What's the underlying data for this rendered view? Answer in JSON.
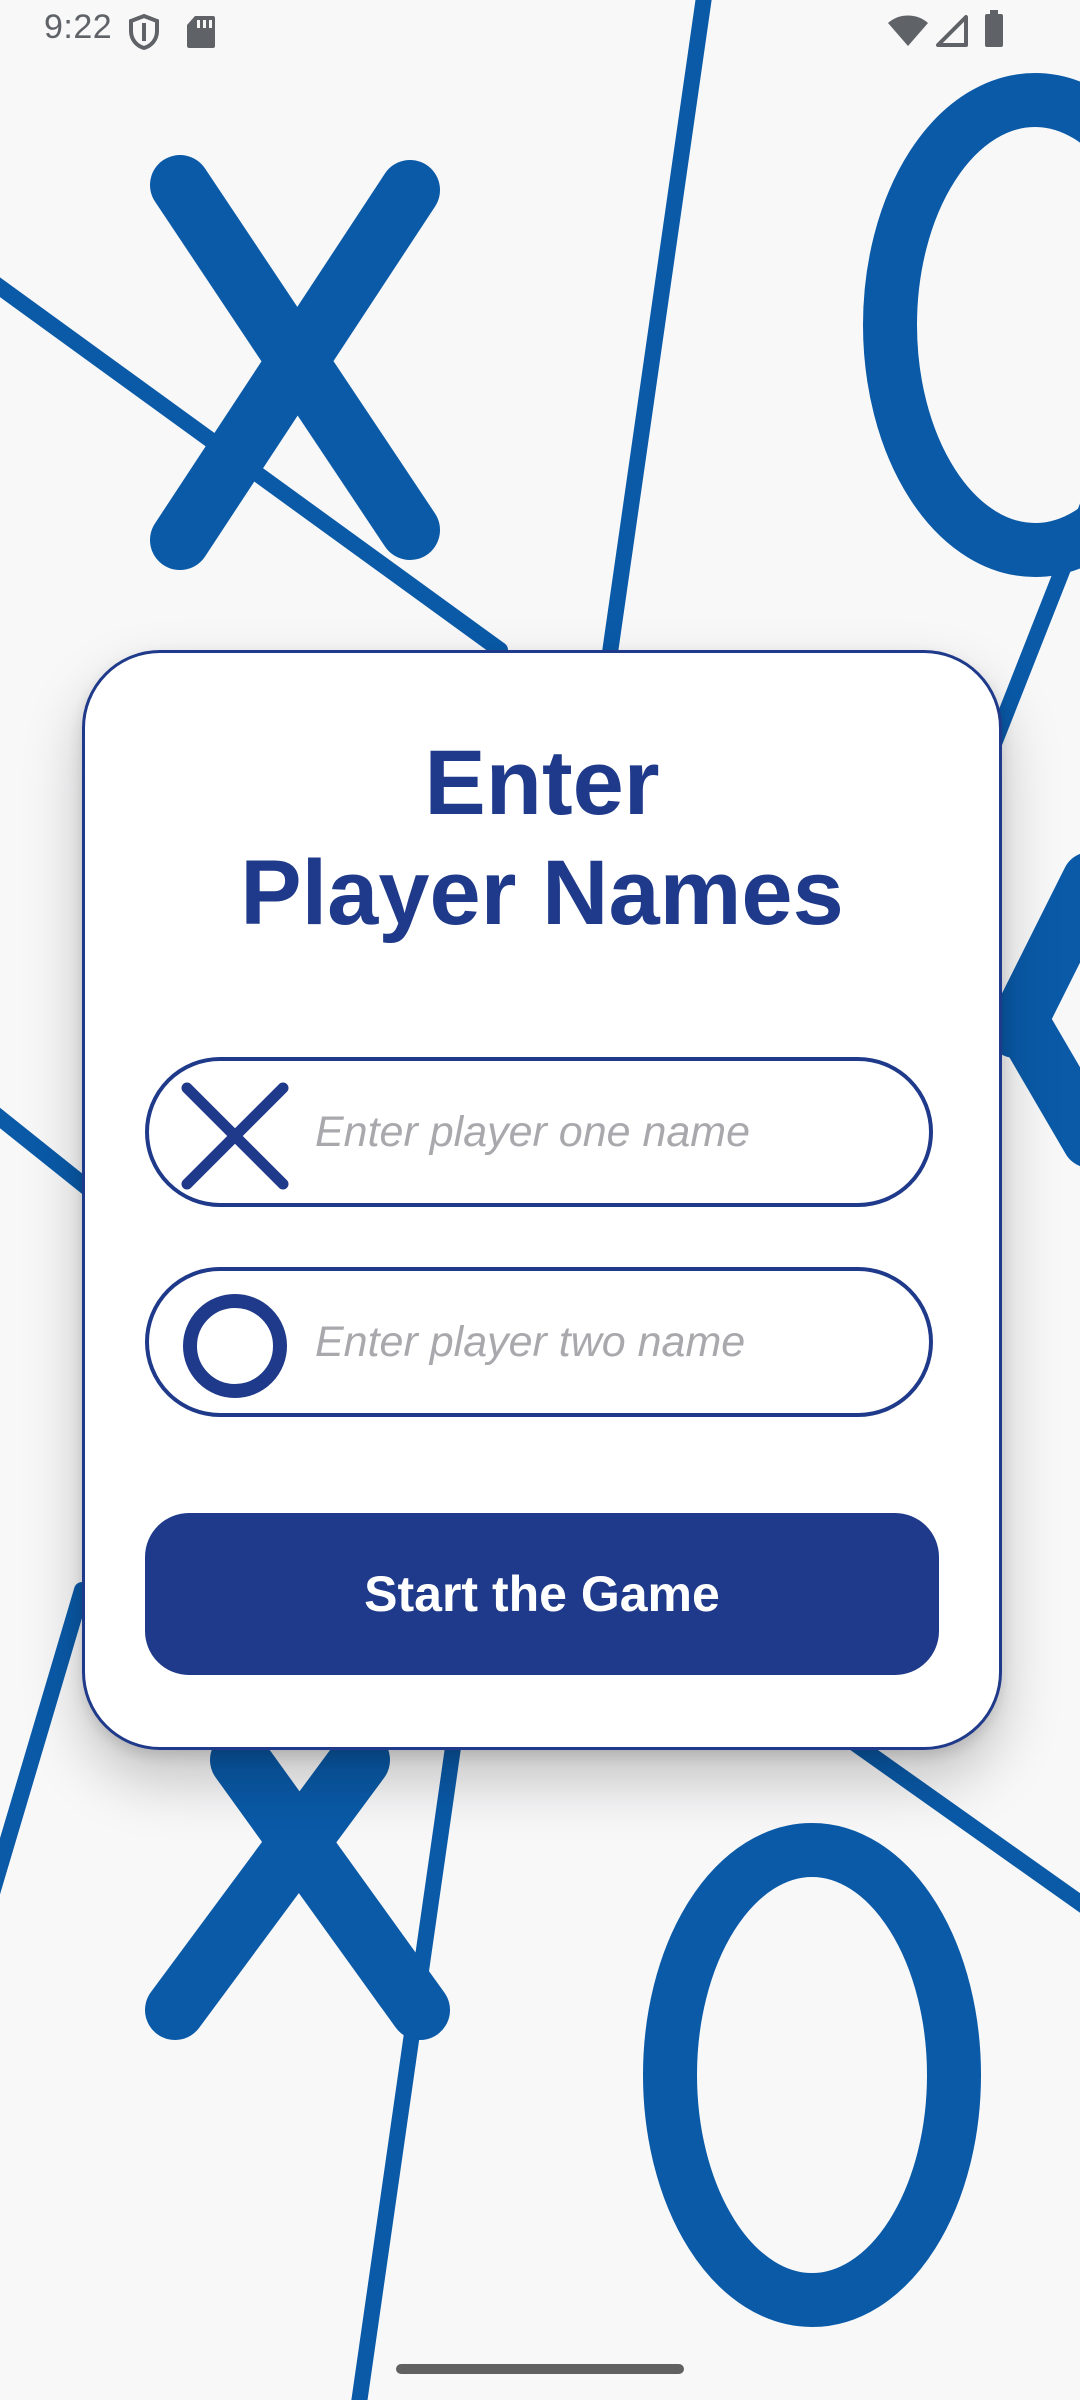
{
  "status_bar": {
    "time": "9:22",
    "left_icons": [
      "shield-icon",
      "sd-card-icon"
    ],
    "right_icons": [
      "wifi-icon",
      "cell-signal-icon",
      "battery-icon"
    ]
  },
  "card": {
    "title_line1": "Enter",
    "title_line2": "Player Names"
  },
  "player_one": {
    "icon": "x-mark-icon",
    "placeholder": "Enter player one name",
    "value": ""
  },
  "player_two": {
    "icon": "o-mark-icon",
    "placeholder": "Enter player two name",
    "value": ""
  },
  "start_button": {
    "label": "Start the Game"
  },
  "colors": {
    "primary": "#1f3a8a",
    "background_marks": "#0a5aa8",
    "page_background": "#f8f8f9",
    "placeholder": "#a9a9ad"
  }
}
